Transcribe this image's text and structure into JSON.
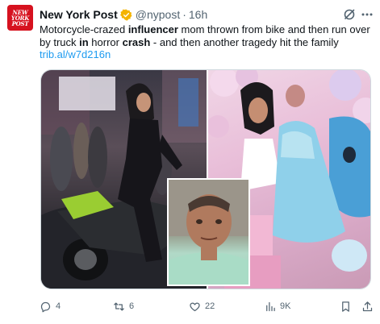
{
  "account": {
    "avatar_lines": [
      "NEW",
      "YORK",
      "POST"
    ],
    "name": "New York Post",
    "handle": "@nypost",
    "separator": "·",
    "time": "16h",
    "verified_color": "#f4b400"
  },
  "post": {
    "text_parts": [
      {
        "text": "Motorcycle-crazed ",
        "bold": false
      },
      {
        "text": "influencer",
        "bold": true
      },
      {
        "text": " mom thrown from bike and then run over by truck ",
        "bold": false
      },
      {
        "text": "in",
        "bold": true
      },
      {
        "text": " horror ",
        "bold": false
      },
      {
        "text": "crash",
        "bold": true
      },
      {
        "text": " - and then another tragedy hit the family",
        "bold": false
      }
    ],
    "link": "trib.al/w7d216n"
  },
  "media": {
    "icons": [
      "photo-left",
      "photo-right",
      "photo-inset"
    ]
  },
  "actions": {
    "replies": "4",
    "reposts": "6",
    "likes": "22",
    "views": "9K"
  },
  "colors": {
    "text": "#0f1419",
    "secondary": "#536471",
    "link": "#1d9bf0",
    "brand": "#d6121f"
  }
}
